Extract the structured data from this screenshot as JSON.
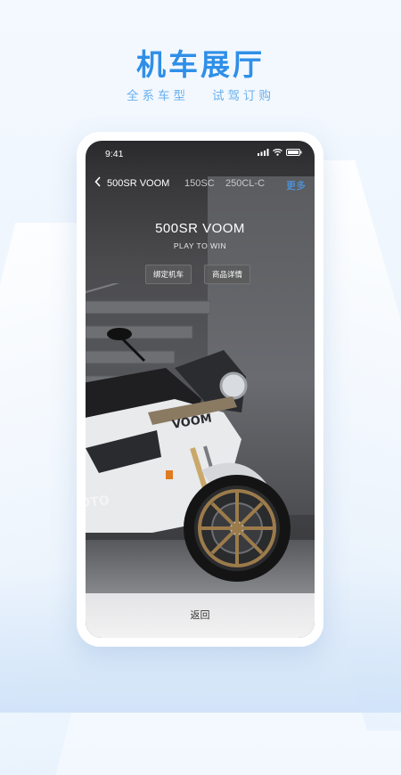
{
  "header": {
    "title": "机车展厅",
    "subtitle_left": "全系车型",
    "subtitle_right": "试驾订购"
  },
  "status_bar": {
    "time": "9:41",
    "icons": [
      "signal-icon",
      "wifi-icon",
      "battery-icon"
    ]
  },
  "model_tabs": {
    "active": "500SR VOOM",
    "items": [
      "150SC",
      "250CL-C"
    ],
    "more": "更多"
  },
  "model": {
    "name": "500SR VOOM",
    "slogan": "PLAY TO WIN",
    "bind_button": "绑定机车",
    "detail_button": "商品详情"
  },
  "moto_markings": {
    "fairing_text": "VOOM",
    "side_text": "MOTO"
  },
  "footer": {
    "return_label": "返回"
  },
  "colors": {
    "title_blue": "#2f8fe8",
    "subtitle_blue": "#6ab0ee",
    "more_blue": "#4aa4ff"
  }
}
